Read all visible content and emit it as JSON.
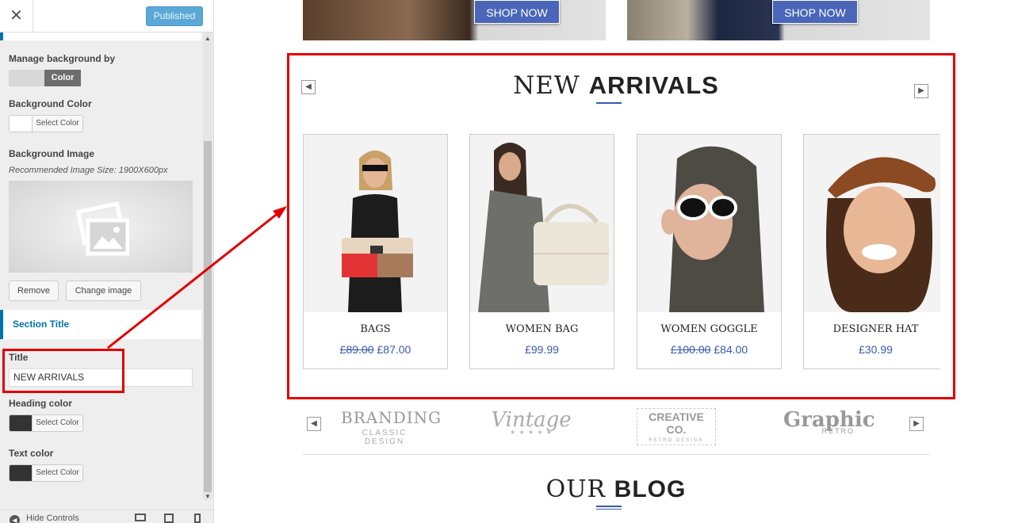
{
  "sidebar": {
    "close_label": "✕",
    "publish_label": "Published",
    "manage_bg_label": "Manage background by",
    "manage_bg_toggle_on": "Color",
    "bg_color_label": "Background Color",
    "select_color_label": "Select Color",
    "bg_image_label": "Background Image",
    "bg_image_note": "Recommended Image Size: 1900X600px",
    "remove_label": "Remove",
    "change_image_label": "Change image",
    "section_title_label": "Section Title",
    "title_label": "Title",
    "title_value": "NEW ARRIVALS",
    "heading_color_label": "Heading color",
    "text_color_label": "Text color",
    "hide_controls_label": "Hide Controls",
    "accent_color": "#0073aa"
  },
  "preview": {
    "shop_now_label": "SHOP NOW",
    "arrivals_title_light": "NEW",
    "arrivals_title_bold": "ARRIVALS",
    "products": [
      {
        "name": "BAGS",
        "old_price": "£89.00",
        "price": "£87.00"
      },
      {
        "name": "WOMEN BAG",
        "old_price": "",
        "price": "£99.99"
      },
      {
        "name": "WOMEN GOGGLE",
        "old_price": "£100.00",
        "price": "£84.00"
      },
      {
        "name": "DESIGNER HAT",
        "old_price": "",
        "price": "£30.99"
      }
    ],
    "brands": [
      {
        "top": "BRANDING",
        "bottom": "CLASSIC DESIGN"
      },
      {
        "top": "Vintage",
        "bottom": "★ ★ ★ ★ ★"
      },
      {
        "top": "CREATIVE CO.",
        "bottom": "RETRO DESIGN"
      },
      {
        "top": "Graphic",
        "bottom": "RETRO"
      }
    ],
    "blog_title_light": "OUR",
    "blog_title_bold": "BLOG",
    "price_color": "#3b5aad",
    "highlight_color": "#e00000"
  }
}
